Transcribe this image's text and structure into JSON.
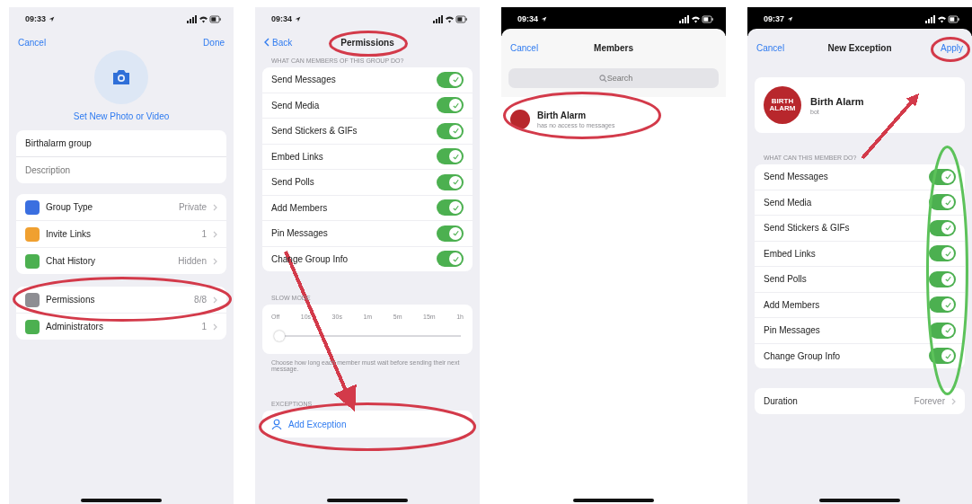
{
  "screens": [
    {
      "kind": "group_settings",
      "status_time": "09:33",
      "dark_status": false,
      "nav_left": "Cancel",
      "nav_right": "Done",
      "photo_link": "Set New Photo or Video",
      "group_name": "Birthalarm group",
      "description_placeholder": "Description",
      "sections": [
        {
          "rows": [
            {
              "label": "Group Type",
              "value": "Private",
              "color": "#3a6fe0"
            },
            {
              "label": "Invite Links",
              "value": "1",
              "color": "#f0a030"
            },
            {
              "label": "Chat History",
              "value": "Hidden",
              "color": "#4cb050"
            }
          ]
        },
        {
          "rows": [
            {
              "label": "Permissions",
              "value": "8/8",
              "color": "#8e8e93",
              "annotation": {
                "kind": "ellipse",
                "color": "#d33a4a"
              }
            },
            {
              "label": "Administrators",
              "value": "1",
              "color": "#4cb050"
            }
          ]
        }
      ]
    },
    {
      "kind": "permissions",
      "status_time": "09:34",
      "dark_status": false,
      "nav_left": "Back",
      "title": "Permissions",
      "title_annotation": {
        "kind": "ellipse",
        "color": "#d33a4a"
      },
      "annotation": {
        "kind": "arrow",
        "color": "#d33a4a"
      },
      "toggles_header": "WHAT CAN MEMBERS OF THIS GROUP DO?",
      "toggles": [
        {
          "label": "Send Messages",
          "on": true
        },
        {
          "label": "Send Media",
          "on": true
        },
        {
          "label": "Send Stickers & GIFs",
          "on": true
        },
        {
          "label": "Embed Links",
          "on": true
        },
        {
          "label": "Send Polls",
          "on": true
        },
        {
          "label": "Add Members",
          "on": true
        },
        {
          "label": "Pin Messages",
          "on": true
        },
        {
          "label": "Change Group Info",
          "on": true
        }
      ],
      "slow_mode": {
        "header": "SLOW MODE",
        "stops": [
          "Off",
          "10s",
          "30s",
          "1m",
          "5m",
          "15m",
          "1h"
        ],
        "level": 0,
        "footer": "Choose how long each member must wait before sending their next message."
      },
      "exceptions_header": "EXCEPTIONS",
      "add_exception": {
        "label": "Add Exception",
        "annotation": {
          "kind": "ellipse",
          "color": "#d33a4a"
        }
      }
    },
    {
      "kind": "members",
      "status_time": "09:34",
      "dark_status": true,
      "nav_left": "Cancel",
      "title": "Members",
      "search_placeholder": "Search",
      "members": [
        {
          "name": "Birth Alarm",
          "subtitle": "has no access to messages",
          "color": "#b8272c",
          "annotation": {
            "kind": "ellipse",
            "color": "#d33a4a"
          }
        }
      ]
    },
    {
      "kind": "new_exception",
      "status_time": "09:37",
      "dark_status": true,
      "nav_left": "Cancel",
      "title": "New Exception",
      "nav_right": "Apply",
      "nav_right_annotation": {
        "kind": "ellipse",
        "color": "#d33a4a"
      },
      "annotation": {
        "kind": "arrow",
        "color": "#d33a4a"
      },
      "member": {
        "name": "Birth Alarm",
        "subtitle": "bot",
        "avatar_text": "BIRTH ALARM",
        "color": "#b8272c"
      },
      "toggles_header": "WHAT CAN THIS MEMBER DO?",
      "toggles_annotation": {
        "kind": "ellipse",
        "color": "#5cc25a"
      },
      "toggles": [
        {
          "label": "Send Messages",
          "on": true
        },
        {
          "label": "Send Media",
          "on": true
        },
        {
          "label": "Send Stickers & GIFs",
          "on": true
        },
        {
          "label": "Embed Links",
          "on": true
        },
        {
          "label": "Send Polls",
          "on": true
        },
        {
          "label": "Add Members",
          "on": true
        },
        {
          "label": "Pin Messages",
          "on": true
        },
        {
          "label": "Change Group Info",
          "on": true
        }
      ],
      "duration": {
        "label": "Duration",
        "value": "Forever"
      }
    }
  ]
}
